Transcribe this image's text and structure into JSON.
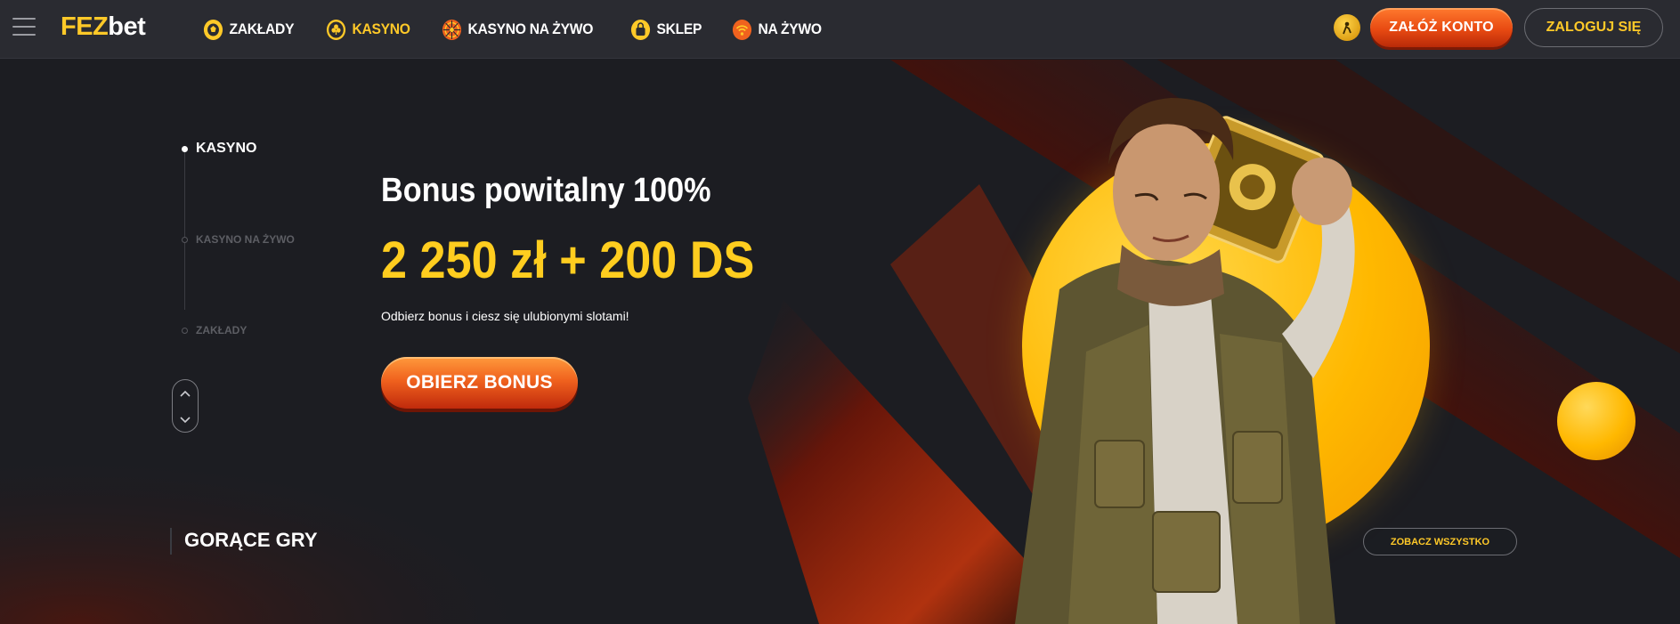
{
  "header": {
    "logo_part1": "FEZ",
    "logo_part2": "bet",
    "nav": [
      {
        "label": "ZAKŁADY",
        "icon": "soccer-ball-icon",
        "active": false
      },
      {
        "label": "KASYNO",
        "icon": "club-icon",
        "active": true
      },
      {
        "label": "KASYNO NA ŻYWO",
        "icon": "roulette-icon",
        "active": false
      },
      {
        "label": "SKLEP",
        "icon": "bag-icon",
        "active": false
      },
      {
        "label": "NA ŻYWO",
        "icon": "live-signal-icon",
        "active": false
      }
    ],
    "register_label": "ZAŁÓŻ KONTO",
    "login_label": "ZALOGUJ SIĘ"
  },
  "side_nav": [
    {
      "label": "KASYNO",
      "active": true
    },
    {
      "label": "KASYNO NA ŻYWO",
      "active": false
    },
    {
      "label": "ZAKŁADY",
      "active": false
    }
  ],
  "hero": {
    "title": "Bonus powitalny 100%",
    "amount": "2 250 zł + 200 DS",
    "subtitle": "Odbierz bonus i ciesz się ulubionymi slotami!",
    "cta_label": "OBIERZ BONUS"
  },
  "section": {
    "title": "GORĄCE GRY",
    "see_all_label": "ZOBACZ WSZYSTKO"
  },
  "colors": {
    "accent_yellow": "#ffc928",
    "cta_orange": "#f0621e",
    "background": "#1c1d22",
    "header_bg": "#2a2b31"
  }
}
